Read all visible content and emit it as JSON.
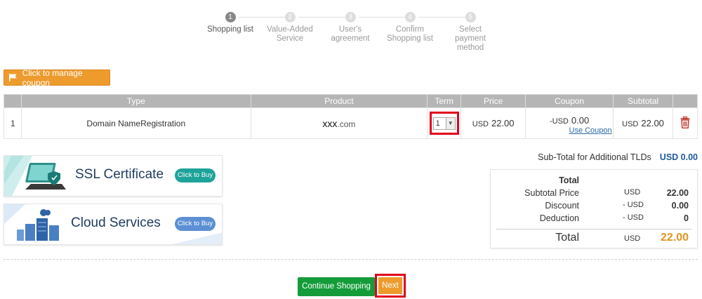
{
  "steps": [
    {
      "num": "1",
      "label": "Shopping list"
    },
    {
      "num": "2",
      "label": "Value-Added Service"
    },
    {
      "num": "3",
      "label": "User's agreement"
    },
    {
      "num": "4",
      "label": "Confirm Shopping list"
    },
    {
      "num": "5",
      "label": "Select payment method"
    }
  ],
  "coupon_button": "Click to manage coupon",
  "table": {
    "headers": [
      "",
      "Type",
      "Product",
      "Term",
      "Price",
      "Coupon",
      "Subtotal",
      ""
    ],
    "row": {
      "index": "1",
      "type": "Domain NameRegistration",
      "product_name": "xxx",
      "product_ext": ".com",
      "term": "1",
      "price_currency": "USD",
      "price": "22.00",
      "coupon_currency": "-USD",
      "coupon": "0.00",
      "use_coupon": "Use Coupon",
      "subtotal_currency": "USD",
      "subtotal": "22.00"
    }
  },
  "banners": {
    "ssl": {
      "title": "SSL Certificate",
      "buy": "Click to Buy"
    },
    "cloud": {
      "title": "Cloud Services",
      "buy": "Click to Buy"
    }
  },
  "subtotal_tlds": {
    "label": "Sub-Total for Additional TLDs",
    "value": "USD 0.00"
  },
  "totals": {
    "heading": "Total",
    "rows": [
      {
        "label": "Subtotal Price",
        "currency": "USD",
        "value": "22.00"
      },
      {
        "label": "Discount",
        "currency": "- USD",
        "value": "0.00"
      },
      {
        "label": "Deduction",
        "currency": "- USD",
        "value": "0"
      }
    ],
    "total_label": "Total",
    "total_currency": "USD",
    "total_value": "22.00"
  },
  "buttons": {
    "continue": "Continue Shopping",
    "next": "Next"
  },
  "colors": {
    "accent": "#ee9b2e",
    "green": "#149c3a",
    "highlight": "#e0001b",
    "link": "#1e5a9e"
  }
}
